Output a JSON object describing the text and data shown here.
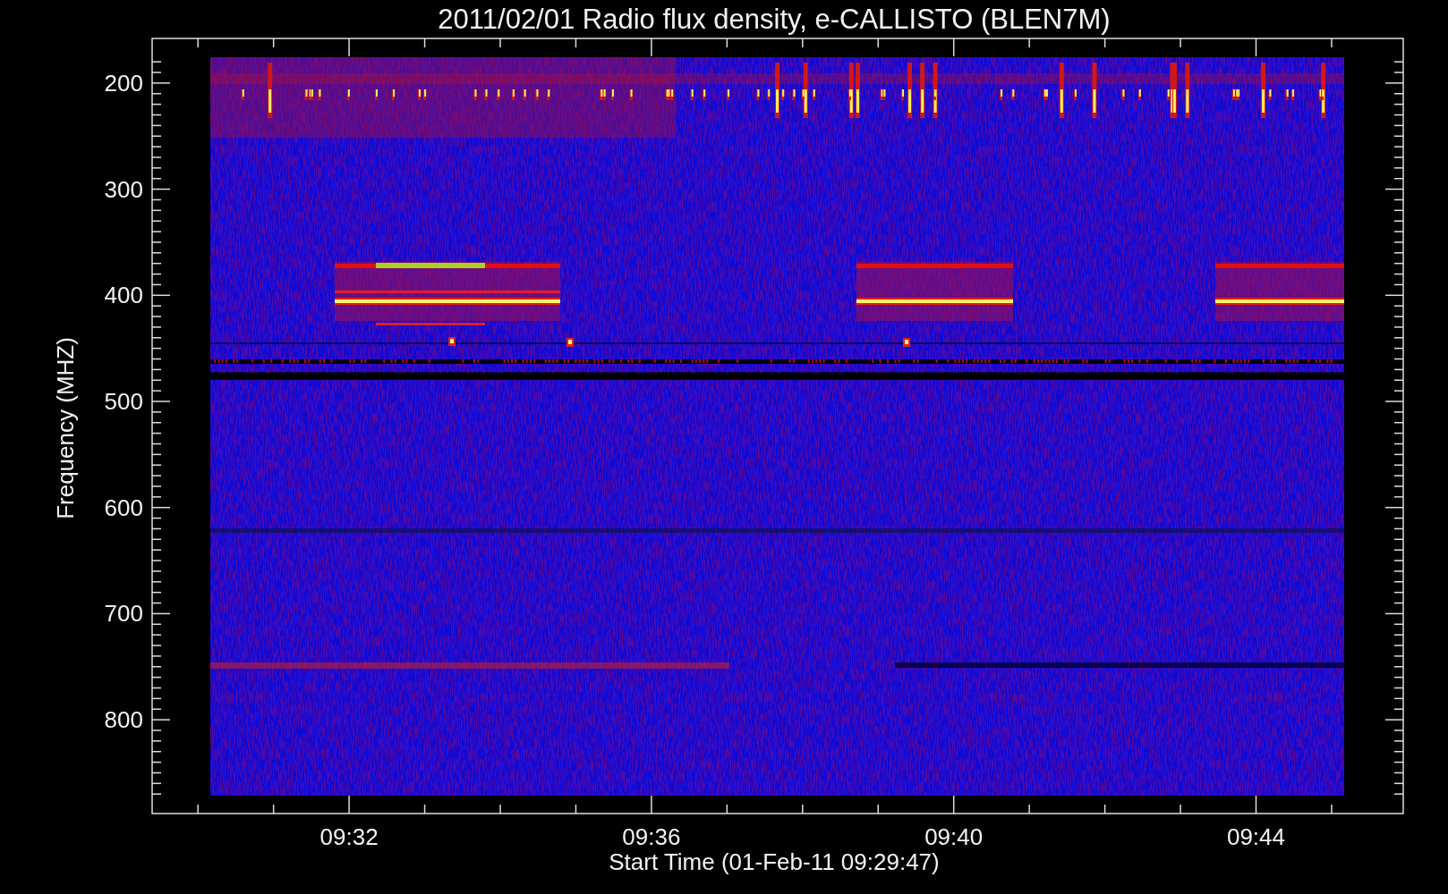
{
  "chart": {
    "title": "2011/02/01  Radio flux density, e-CALLISTO (BLEN7M)",
    "xlabel": "Start Time (01-Feb-11 09:29:47)",
    "ylabel": "Frequency (MHZ)",
    "xticks": [
      "09:32",
      "09:36",
      "09:40",
      "09:44"
    ],
    "yticks": [
      "200",
      "300",
      "400",
      "500",
      "600",
      "700",
      "800"
    ]
  }
}
